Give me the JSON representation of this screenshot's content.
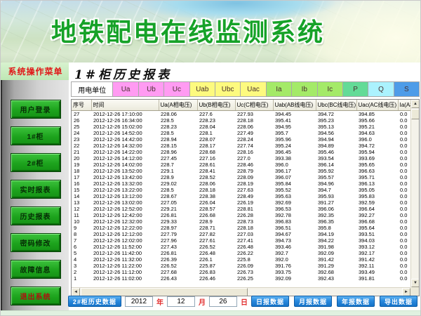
{
  "header": {
    "title": "地铁配电在线监测系统"
  },
  "sidebar": {
    "title": "系统操作菜单",
    "items": [
      {
        "label": "用户登录"
      },
      {
        "label": "1#柜"
      },
      {
        "label": "2#柜"
      },
      {
        "label": "实时报表"
      },
      {
        "label": "历史报表"
      },
      {
        "label": "密码修改"
      },
      {
        "label": "故障信息"
      },
      {
        "label": "退出系统"
      }
    ]
  },
  "main": {
    "report_title": "1#柜历史报表",
    "unit_bar": [
      {
        "label": "用电单位",
        "color": "#FFFFFF"
      },
      {
        "label": "Ua",
        "color": "#FF9BF2"
      },
      {
        "label": "Ub",
        "color": "#FF9BF2"
      },
      {
        "label": "Uc",
        "color": "#FF9BF2"
      },
      {
        "label": "Uab",
        "color": "#FDFA7F"
      },
      {
        "label": "Ubc",
        "color": "#FDFA7F"
      },
      {
        "label": "Uac",
        "color": "#FDFA7F"
      },
      {
        "label": "Ia",
        "color": "#A4EA68"
      },
      {
        "label": "Ib",
        "color": "#A4EA68"
      },
      {
        "label": "Ic",
        "color": "#A4EA68"
      },
      {
        "label": "P",
        "color": "#63DB97"
      },
      {
        "label": "Q",
        "color": "#ABF2FE"
      },
      {
        "label": "S",
        "color": "#4E9CE8"
      }
    ],
    "table": {
      "columns": [
        "序号",
        "时间",
        "Ua(A相电压)",
        "Ub(B相电压)",
        "Uc(C相电压)",
        "Uab(AB线电压)",
        "Ubc(BC线电压)",
        "Uac(AC线电压)",
        "Ia(A相"
      ],
      "rows": [
        [
          "27",
          "2012-12-26 17:10:00",
          "228.06",
          "227.6",
          "227.93",
          "394.45",
          "394.72",
          "394.85",
          "0.0"
        ],
        [
          "26",
          "2012-12-26 16:34:00",
          "228.5",
          "228.23",
          "228.18",
          "395.41",
          "395.23",
          "395.66",
          "0.0"
        ],
        [
          "25",
          "2012-12-26 15:02:00",
          "228.23",
          "228.04",
          "228.06",
          "394.95",
          "395.13",
          "395.21",
          "0.0"
        ],
        [
          "24",
          "2012-12-26 14:52:00",
          "228.5",
          "228.1",
          "227.49",
          "395.7",
          "394.56",
          "394.63",
          "0.0"
        ],
        [
          "23",
          "2012-12-26 14:42:00",
          "228.94",
          "228.07",
          "228.24",
          "395.96",
          "394.94",
          "396.0",
          "0.0"
        ],
        [
          "22",
          "2012-12-26 14:32:00",
          "228.15",
          "228.17",
          "227.74",
          "395.24",
          "394.89",
          "394.72",
          "0.0"
        ],
        [
          "21",
          "2012-12-26 14:22:00",
          "228.96",
          "228.68",
          "228.16",
          "396.45",
          "395.46",
          "395.94",
          "0.0"
        ],
        [
          "20",
          "2012-12-26 14:12:00",
          "227.45",
          "227.16",
          "227.0",
          "393.38",
          "393.54",
          "393.69",
          "0.0"
        ],
        [
          "19",
          "2012-12-26 14:02:00",
          "228.7",
          "228.61",
          "228.46",
          "396.0",
          "396.14",
          "395.65",
          "0.0"
        ],
        [
          "18",
          "2012-12-26 13:52:00",
          "229.1",
          "228.41",
          "228.79",
          "396.17",
          "395.92",
          "396.63",
          "0.0"
        ],
        [
          "17",
          "2012-12-26 13:42:00",
          "228.9",
          "228.52",
          "228.09",
          "396.07",
          "395.57",
          "395.71",
          "0.0"
        ],
        [
          "16",
          "2012-12-26 13:32:00",
          "229.02",
          "228.06",
          "228.19",
          "395.84",
          "394.96",
          "396.13",
          "0.0"
        ],
        [
          "15",
          "2012-12-26 13:22:00",
          "228.5",
          "228.18",
          "227.63",
          "395.52",
          "394.7",
          "395.05",
          "0.0"
        ],
        [
          "14",
          "2012-12-26 13:12:00",
          "228.67",
          "228.38",
          "228.49",
          "395.63",
          "395.93",
          "395.83",
          "0.0"
        ],
        [
          "13",
          "2012-12-26 13:02:00",
          "227.05",
          "226.04",
          "226.19",
          "392.69",
          "391.27",
          "392.59",
          "0.0"
        ],
        [
          "12",
          "2012-12-26 12:52:00",
          "229.21",
          "228.57",
          "228.81",
          "396.53",
          "396.06",
          "396.64",
          "0.0"
        ],
        [
          "11",
          "2012-12-26 12:42:00",
          "226.81",
          "226.68",
          "226.28",
          "392.78",
          "392.35",
          "392.27",
          "0.0"
        ],
        [
          "10",
          "2012-12-26 12:32:00",
          "229.33",
          "228.9",
          "228.73",
          "396.83",
          "396.35",
          "396.68",
          "0.0"
        ],
        [
          "9",
          "2012-12-26 12:22:00",
          "228.97",
          "228.71",
          "228.18",
          "396.51",
          "395.8",
          "395.64",
          "0.0"
        ],
        [
          "8",
          "2012-12-26 12:12:00",
          "227.79",
          "227.82",
          "227.03",
          "394.67",
          "394.19",
          "393.51",
          "0.0"
        ],
        [
          "7",
          "2012-12-26 12:02:00",
          "227.96",
          "227.61",
          "227.41",
          "394.73",
          "394.22",
          "394.03",
          "0.0"
        ],
        [
          "6",
          "2012-12-26 11:52:00",
          "227.43",
          "226.52",
          "226.48",
          "393.46",
          "391.98",
          "393.12",
          "0.0"
        ],
        [
          "5",
          "2012-12-26 11:42:00",
          "226.81",
          "226.48",
          "226.22",
          "392.7",
          "392.09",
          "392.17",
          "0.0"
        ],
        [
          "4",
          "2012-12-26 11:32:00",
          "226.39",
          "226.1",
          "225.8",
          "392.0",
          "391.42",
          "391.42",
          "0.0"
        ],
        [
          "3",
          "2012-12-26 11:22:00",
          "226.52",
          "225.87",
          "226.09",
          "391.76",
          "391.29",
          "392.11",
          "0.0"
        ],
        [
          "2",
          "2012-12-26 11:12:00",
          "227.68",
          "226.83",
          "226.73",
          "393.75",
          "392.68",
          "393.49",
          "0.0"
        ],
        [
          "1",
          "2012-12-26 11:02:00",
          "226.43",
          "226.46",
          "226.25",
          "392.09",
          "392.43",
          "391.81",
          "0.0"
        ]
      ]
    },
    "footer": {
      "cabinet2_button": "2#柜历史数据",
      "year": "2012",
      "year_label": "年",
      "month": "12",
      "month_label": "月",
      "day": "26",
      "day_label": "日",
      "buttons": [
        "日报数据",
        "月报数据",
        "年报数据",
        "导出数据"
      ]
    }
  },
  "scrollbar": {
    "up": "▲",
    "down": "▼",
    "left": "◄",
    "right": "►"
  }
}
